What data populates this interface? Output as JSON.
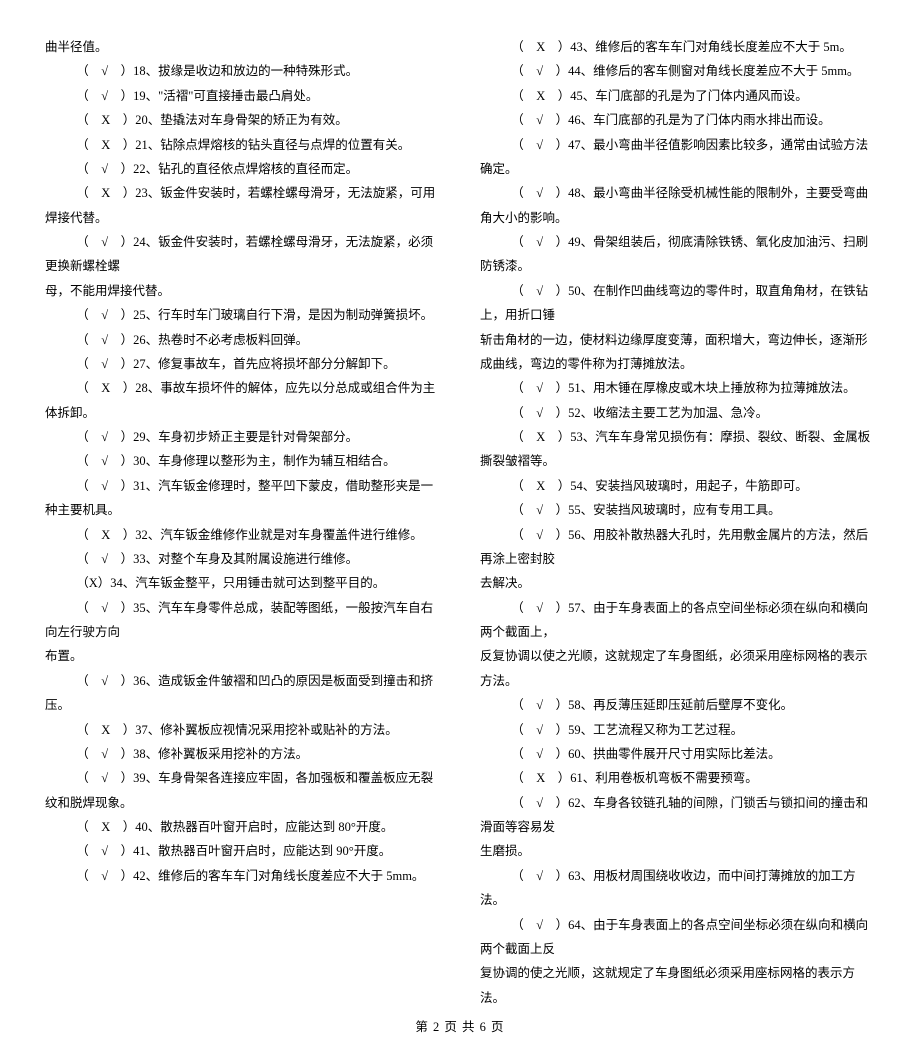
{
  "left": {
    "pre": "曲半径值。",
    "items": [
      "（　√　）18、拔缘是收边和放边的一种特殊形式。",
      "（　√　）19、\"活褶\"可直接捶击最凸肩处。",
      "（　X　）20、垫撬法对车身骨架的矫正为有效。",
      "（　X　）21、钻除点焊熔核的钻头直径与点焊的位置有关。",
      "（　√　）22、钻孔的直径依点焊熔核的直径而定。",
      "（　X　）23、钣金件安装时，若螺栓螺母滑牙，无法旋紧，可用焊接代替。",
      "（　√　）24、钣金件安装时，若螺栓螺母滑牙，无法旋紧，必须更换新螺栓螺"
    ],
    "cont1": "母，不能用焊接代替。",
    "items2": [
      "（　√　）25、行车时车门玻璃自行下滑，是因为制动弹簧损坏。",
      "（　√　）26、热卷时不必考虑板料回弹。",
      "（　√　）27、修复事故车，首先应将损坏部分分解卸下。",
      "（　X　）28、事故车损坏件的解体，应先以分总成或组合件为主体拆卸。",
      "（　√　）29、车身初步矫正主要是针对骨架部分。",
      "（　√　）30、车身修理以整形为主，制作为辅互相结合。",
      "（　√　）31、汽车钣金修理时，整平凹下蒙皮，借助整形夹是一种主要机具。",
      "（　X　）32、汽车钣金维修作业就是对车身覆盖件进行维修。",
      "（　√　）33、对整个车身及其附属设施进行维修。",
      "（X）34、汽车钣金整平，只用锤击就可达到整平目的。",
      "（　√　）35、汽车车身零件总成，装配等图纸，一般按汽车自右向左行驶方向"
    ],
    "cont2": "布置。",
    "items3": [
      "（　√　）36、造成钣金件皱褶和凹凸的原因是板面受到撞击和挤压。",
      "（　X　）37、修补翼板应视情况采用挖补或贴补的方法。",
      "（　√　）38、修补翼板采用挖补的方法。",
      "（　√　）39、车身骨架各连接应牢固，各加强板和覆盖板应无裂纹和脱焊现象。",
      "（　X　）40、散热器百叶窗开启时，应能达到 80°开度。",
      "（　√　）41、散热器百叶窗开启时，应能达到 90°开度。",
      "（　√　）42、维修后的客车车门对角线长度差应不大于 5mm。"
    ]
  },
  "right": {
    "items": [
      "（　X　）43、维修后的客车车门对角线长度差应不大于 5m。",
      "（　√　）44、维修后的客车侧窗对角线长度差应不大于 5mm。",
      "（　X　）45、车门底部的孔是为了门体内通风而设。",
      "（　√　）46、车门底部的孔是为了门体内雨水排出而设。",
      "（　√　）47、最小弯曲半径值影响因素比较多，通常由试验方法确定。",
      "（　√　）48、最小弯曲半径除受机械性能的限制外，主要受弯曲角大小的影响。",
      "（　√　）49、骨架组装后，彻底清除铁锈、氧化皮加油污、扫刷防锈漆。",
      "（　√　）50、在制作凹曲线弯边的零件时，取直角角材，在铁钻上，用折口锤"
    ],
    "cont1": "斩击角材的一边，使材料边缘厚度变薄，面积增大，弯边伸长，逐渐形成曲线，弯边的零件称为打薄摊放法。",
    "items2": [
      "（　√　）51、用木锤在厚橡皮或木块上捶放称为拉薄摊放法。",
      "（　√　）52、收缩法主要工艺为加温、急冷。",
      "（　X　）53、汽车车身常见损伤有：摩损、裂纹、断裂、金属板撕裂皱褶等。",
      "（　X　）54、安装挡风玻璃时，用起子，牛筋即可。",
      "（　√　）55、安装挡风玻璃时，应有专用工具。",
      "（　√　）56、用胶补散热器大孔时，先用敷金属片的方法，然后再涂上密封胶"
    ],
    "cont2": "去解决。",
    "items3": [
      "（　√　）57、由于车身表面上的各点空间坐标必须在纵向和横向两个截面上，"
    ],
    "cont3": "反复协调以使之光顺，这就规定了车身图纸，必须采用座标网格的表示方法。",
    "items4": [
      "（　√　）58、再反薄压延即压延前后壁厚不变化。",
      "（　√　）59、工艺流程又称为工艺过程。",
      "（　√　）60、拱曲零件展开尺寸用实际比差法。",
      "（　X　）61、利用卷板机弯板不需要预弯。",
      "（　√　）62、车身各铰链孔轴的间隙，门锁舌与锁扣间的撞击和滑面等容易发"
    ],
    "cont4": "生磨损。",
    "items5": [
      "（　√　）63、用板材周围绕收收边，而中间打薄摊放的加工方法。",
      "（　√　）64、由于车身表面上的各点空间坐标必须在纵向和横向两个截面上反"
    ],
    "cont5": "复协调的使之光顺，这就规定了车身图纸必须采用座标网格的表示方法。"
  },
  "footer": "第 2 页 共 6 页"
}
